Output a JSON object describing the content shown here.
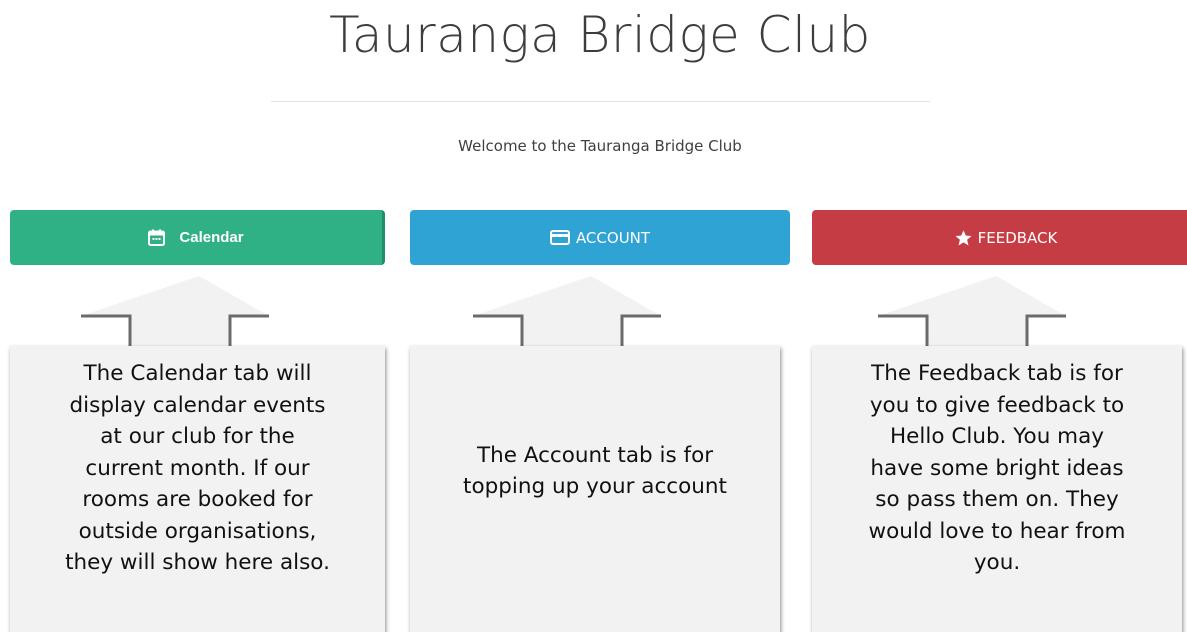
{
  "header": {
    "title": "Tauranga Bridge Club",
    "welcome": "Welcome to the Tauranga Bridge Club"
  },
  "tabs": [
    {
      "label": "Calendar",
      "icon": "calendar-icon",
      "color": "#2fb185"
    },
    {
      "label": "ACCOUNT",
      "icon": "credit-card-icon",
      "color": "#2fa3d3"
    },
    {
      "label": "FEEDBACK",
      "icon": "star-icon",
      "color": "#c63c44"
    }
  ],
  "callouts": {
    "calendar": [
      "The Calendar tab will",
      "display calendar events",
      "at our club for the",
      "current month.  If our",
      "rooms are booked for",
      "outside organisations,",
      "they will show here also."
    ],
    "account": [
      "The Account tab is for",
      "topping up your account"
    ],
    "feedback": [
      "The Feedback tab is for",
      "you to give feedback to",
      "Hello Club.  You may",
      "have some bright ideas",
      "so pass them on. They",
      "would love to hear from",
      "you."
    ]
  }
}
